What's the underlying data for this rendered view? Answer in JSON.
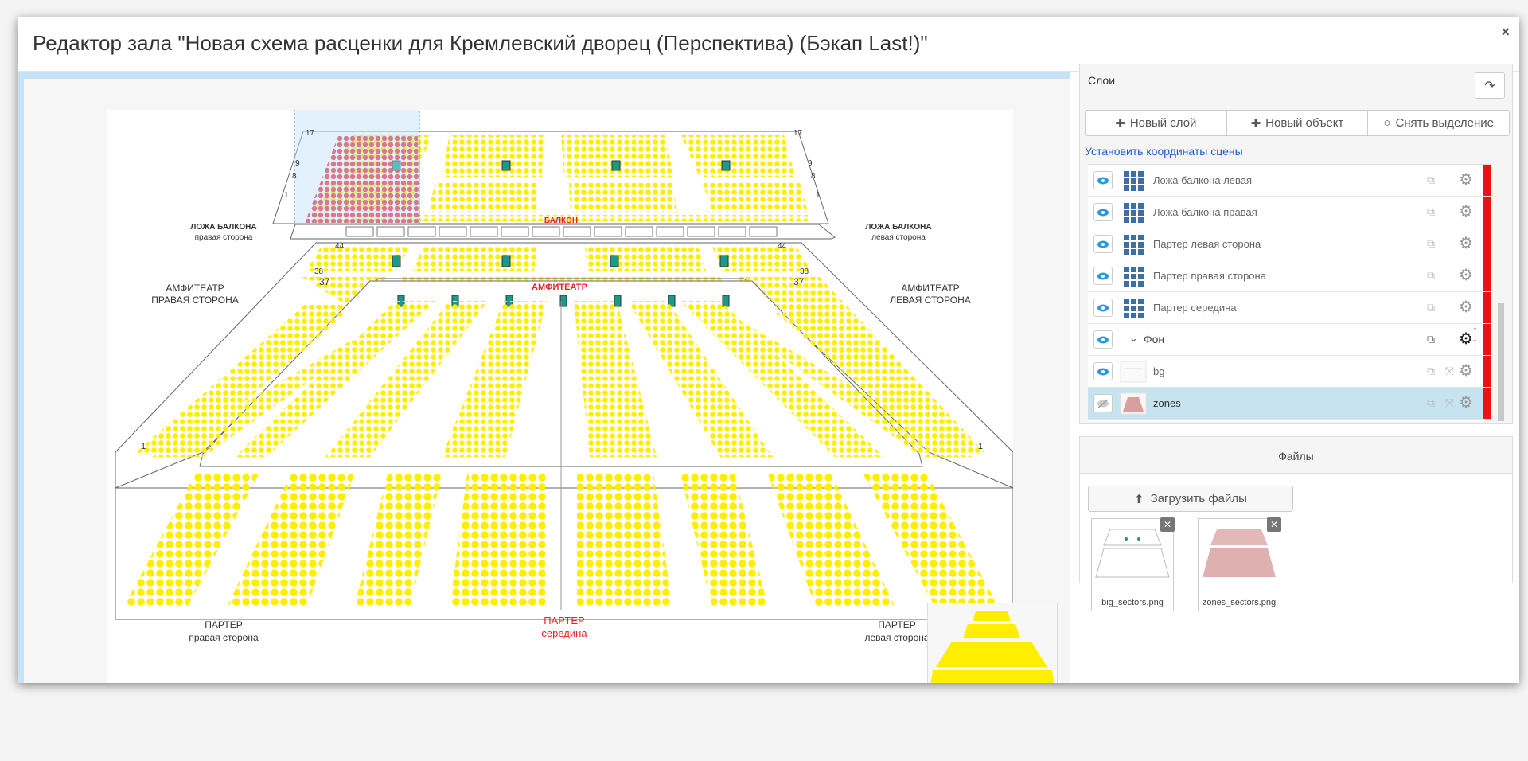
{
  "modal": {
    "title": "Редактор зала \"Новая схема расценки для Кремлевский дворец (Перспектива) (Бэкап Last!)\"",
    "close_icon": "×"
  },
  "scene": {
    "labels": {
      "balkon": "БАЛКОН",
      "amfiteatr": "АМФИТЕАТР",
      "parter_seredina_1": "ПАРТЕР",
      "parter_seredina_2": "середина",
      "parter_right_1": "ПАРТЕР",
      "parter_right_2": "правая сторона",
      "parter_left_1": "ПАРТЕР",
      "parter_left_2": "левая сторона",
      "amf_right_1": "АМФИТЕАТР",
      "amf_right_2": "ПРАВАЯ СТОРОНА",
      "amf_left_1": "АМФИТЕАТР",
      "amf_left_2": "ЛЕВАЯ СТОРОНА",
      "loja_right_1": "ЛОЖА БАЛКОНА",
      "loja_right_2": "правая сторона",
      "loja_left_1": "ЛОЖА БАЛКОНА",
      "loja_left_2": "левая сторона",
      "row_17": "17",
      "row_9": "9",
      "row_8": "8",
      "row_1": "1",
      "row_44": "44",
      "row_38": "38",
      "row_37": "37"
    },
    "colors": {
      "seat": "#ffee00",
      "selected_seat": "#e8253a",
      "selection": "#bfe0f7",
      "pillar": "#1a9a8a",
      "label_red": "#e8202a"
    }
  },
  "layers_panel": {
    "title": "Слои",
    "share_icon": "share-icon",
    "buttons": {
      "new_layer": "Новый слой",
      "new_object": "Новый объект",
      "deselect": "Снять выделение"
    },
    "set_coords_link": "Установить координаты сцены",
    "items": [
      {
        "name": "Ложа балкона левая",
        "icon": "grid-icon"
      },
      {
        "name": "Ложа балкона правая",
        "icon": "grid-icon"
      },
      {
        "name": "Партер левая сторона",
        "icon": "grid-icon"
      },
      {
        "name": "Партер правая сторона",
        "icon": "grid-icon"
      },
      {
        "name": "Партер середина",
        "icon": "grid-icon"
      }
    ],
    "group": {
      "name": "Фон"
    },
    "images": [
      {
        "name": "bg",
        "visible": true,
        "selected": false
      },
      {
        "name": "zones",
        "visible": false,
        "selected": true
      }
    ]
  },
  "files_panel": {
    "title": "Файлы",
    "upload_button": "Загрузить файлы",
    "files": [
      {
        "name": "big_sectors.png"
      },
      {
        "name": "zones_sectors.png"
      }
    ]
  }
}
